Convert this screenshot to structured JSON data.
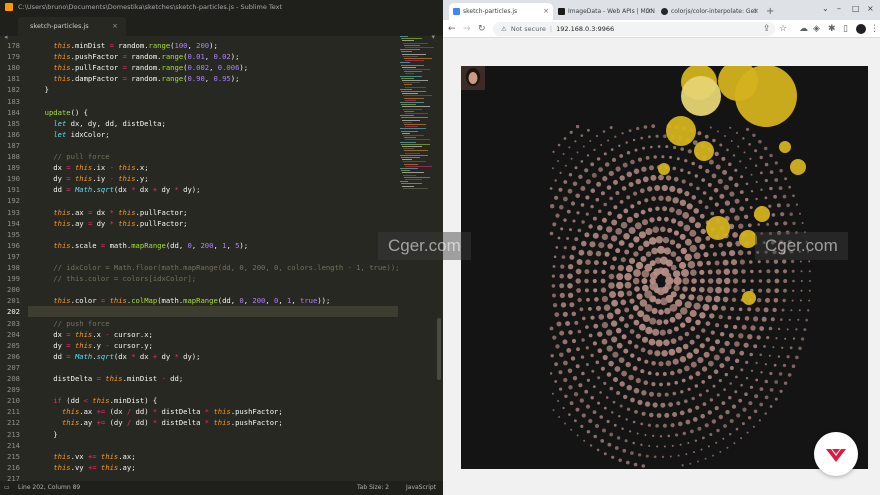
{
  "editor": {
    "title": "C:\\Users\\bruno\\Documents\\Domestika\\sketches\\sketch-particles.js - Sublime Text",
    "tab_label": "sketch-particles.js",
    "status": {
      "position": "Line 202, Column 89",
      "tab_size": "Tab Size: 2",
      "syntax": "JavaScript"
    },
    "line_numbers": [
      "178",
      "179",
      "180",
      "181",
      "182",
      "183",
      "184",
      "185",
      "186",
      "187",
      "188",
      "189",
      "190",
      "191",
      "192",
      "193",
      "194",
      "195",
      "196",
      "197",
      "198",
      "199",
      "200",
      "201",
      "202",
      "203",
      "204",
      "205",
      "206",
      "207",
      "208",
      "209",
      "210",
      "211",
      "212",
      "213",
      "214",
      "215",
      "216",
      "217"
    ],
    "current_line": "202",
    "code_lines": [
      [
        {
          "t": "    "
        },
        {
          "t": "this",
          "c": "th"
        },
        {
          "t": ".minDist "
        },
        {
          "t": "=",
          "c": "op"
        },
        {
          "t": " random."
        },
        {
          "t": "range",
          "c": "fn"
        },
        {
          "t": "("
        },
        {
          "t": "100",
          "c": "nu"
        },
        {
          "t": ", "
        },
        {
          "t": "200",
          "c": "nu"
        },
        {
          "t": ");"
        }
      ],
      [
        {
          "t": "    "
        },
        {
          "t": "this",
          "c": "th"
        },
        {
          "t": ".pushFactor "
        },
        {
          "t": "=",
          "c": "op"
        },
        {
          "t": " random."
        },
        {
          "t": "range",
          "c": "fn"
        },
        {
          "t": "("
        },
        {
          "t": "0.01",
          "c": "nu"
        },
        {
          "t": ", "
        },
        {
          "t": "0.02",
          "c": "nu"
        },
        {
          "t": ");"
        }
      ],
      [
        {
          "t": "    "
        },
        {
          "t": "this",
          "c": "th"
        },
        {
          "t": ".pullFactor "
        },
        {
          "t": "=",
          "c": "op"
        },
        {
          "t": " random."
        },
        {
          "t": "range",
          "c": "fn"
        },
        {
          "t": "("
        },
        {
          "t": "0.002",
          "c": "nu"
        },
        {
          "t": ", "
        },
        {
          "t": "0.006",
          "c": "nu"
        },
        {
          "t": ");"
        }
      ],
      [
        {
          "t": "    "
        },
        {
          "t": "this",
          "c": "th"
        },
        {
          "t": ".dampFactor "
        },
        {
          "t": "=",
          "c": "op"
        },
        {
          "t": " random."
        },
        {
          "t": "range",
          "c": "fn"
        },
        {
          "t": "("
        },
        {
          "t": "0.90",
          "c": "nu"
        },
        {
          "t": ", "
        },
        {
          "t": "0.95",
          "c": "nu"
        },
        {
          "t": ");"
        }
      ],
      [
        {
          "t": "  }"
        }
      ],
      [
        {
          "t": ""
        }
      ],
      [
        {
          "t": "  "
        },
        {
          "t": "update",
          "c": "fn"
        },
        {
          "t": "() {"
        }
      ],
      [
        {
          "t": "    "
        },
        {
          "t": "let",
          "c": "kw"
        },
        {
          "t": " dx, dy, dd, distDelta;"
        }
      ],
      [
        {
          "t": "    "
        },
        {
          "t": "let",
          "c": "kw"
        },
        {
          "t": " idxColor;"
        }
      ],
      [
        {
          "t": ""
        }
      ],
      [
        {
          "t": "    "
        },
        {
          "t": "// pull force",
          "c": "cm"
        }
      ],
      [
        {
          "t": "    dx "
        },
        {
          "t": "=",
          "c": "op"
        },
        {
          "t": " "
        },
        {
          "t": "this",
          "c": "th"
        },
        {
          "t": ".ix "
        },
        {
          "t": "-",
          "c": "op"
        },
        {
          "t": " "
        },
        {
          "t": "this",
          "c": "th"
        },
        {
          "t": ".x;"
        }
      ],
      [
        {
          "t": "    dy "
        },
        {
          "t": "=",
          "c": "op"
        },
        {
          "t": " "
        },
        {
          "t": "this",
          "c": "th"
        },
        {
          "t": ".iy "
        },
        {
          "t": "-",
          "c": "op"
        },
        {
          "t": " "
        },
        {
          "t": "this",
          "c": "th"
        },
        {
          "t": ".y;"
        }
      ],
      [
        {
          "t": "    dd "
        },
        {
          "t": "=",
          "c": "op"
        },
        {
          "t": " "
        },
        {
          "t": "Math",
          "c": "kw"
        },
        {
          "t": "."
        },
        {
          "t": "sqrt",
          "c": "kw"
        },
        {
          "t": "(dx "
        },
        {
          "t": "*",
          "c": "op"
        },
        {
          "t": " dx "
        },
        {
          "t": "+",
          "c": "op"
        },
        {
          "t": " dy "
        },
        {
          "t": "*",
          "c": "op"
        },
        {
          "t": " dy);"
        }
      ],
      [
        {
          "t": ""
        }
      ],
      [
        {
          "t": "    "
        },
        {
          "t": "this",
          "c": "th"
        },
        {
          "t": ".ax "
        },
        {
          "t": "=",
          "c": "op"
        },
        {
          "t": " dx "
        },
        {
          "t": "*",
          "c": "op"
        },
        {
          "t": " "
        },
        {
          "t": "this",
          "c": "th"
        },
        {
          "t": ".pullFactor;"
        }
      ],
      [
        {
          "t": "    "
        },
        {
          "t": "this",
          "c": "th"
        },
        {
          "t": ".ay "
        },
        {
          "t": "=",
          "c": "op"
        },
        {
          "t": " dy "
        },
        {
          "t": "*",
          "c": "op"
        },
        {
          "t": " "
        },
        {
          "t": "this",
          "c": "th"
        },
        {
          "t": ".pullFactor;"
        }
      ],
      [
        {
          "t": ""
        }
      ],
      [
        {
          "t": "    "
        },
        {
          "t": "this",
          "c": "th"
        },
        {
          "t": ".scale "
        },
        {
          "t": "=",
          "c": "op"
        },
        {
          "t": " math."
        },
        {
          "t": "mapRange",
          "c": "fn"
        },
        {
          "t": "(dd, "
        },
        {
          "t": "0",
          "c": "nu"
        },
        {
          "t": ", "
        },
        {
          "t": "200",
          "c": "nu"
        },
        {
          "t": ", "
        },
        {
          "t": "1",
          "c": "nu"
        },
        {
          "t": ", "
        },
        {
          "t": "5",
          "c": "nu"
        },
        {
          "t": ");"
        }
      ],
      [
        {
          "t": ""
        }
      ],
      [
        {
          "t": "    // idxColor = Math.floor(math.mapRange(dd, 0, 200, 0, colors.length - 1, true));",
          "c": "cm"
        }
      ],
      [
        {
          "t": "    // this.color = colors[idxColor];",
          "c": "cm"
        }
      ],
      [
        {
          "t": ""
        }
      ],
      [
        {
          "t": "    "
        },
        {
          "t": "this",
          "c": "th"
        },
        {
          "t": ".color "
        },
        {
          "t": "=",
          "c": "op"
        },
        {
          "t": " "
        },
        {
          "t": "this",
          "c": "th"
        },
        {
          "t": "."
        },
        {
          "t": "colMap",
          "c": "fn"
        },
        {
          "t": "(math."
        },
        {
          "t": "mapRange",
          "c": "fn"
        },
        {
          "t": "(dd, "
        },
        {
          "t": "0",
          "c": "nu"
        },
        {
          "t": ", "
        },
        {
          "t": "200",
          "c": "nu"
        },
        {
          "t": ", "
        },
        {
          "t": "0",
          "c": "nu"
        },
        {
          "t": ", "
        },
        {
          "t": "1",
          "c": "nu"
        },
        {
          "t": ", "
        },
        {
          "t": "true",
          "c": "nu"
        },
        {
          "t": "));"
        }
      ],
      [
        {
          "t": ""
        }
      ],
      [
        {
          "t": "    "
        },
        {
          "t": "// push force",
          "c": "cm"
        }
      ],
      [
        {
          "t": "    dx "
        },
        {
          "t": "=",
          "c": "op"
        },
        {
          "t": " "
        },
        {
          "t": "this",
          "c": "th"
        },
        {
          "t": ".x "
        },
        {
          "t": "-",
          "c": "op"
        },
        {
          "t": " cursor.x;"
        }
      ],
      [
        {
          "t": "    dy "
        },
        {
          "t": "=",
          "c": "op"
        },
        {
          "t": " "
        },
        {
          "t": "this",
          "c": "th"
        },
        {
          "t": ".y "
        },
        {
          "t": "-",
          "c": "op"
        },
        {
          "t": " cursor.y;"
        }
      ],
      [
        {
          "t": "    dd "
        },
        {
          "t": "=",
          "c": "op"
        },
        {
          "t": " "
        },
        {
          "t": "Math",
          "c": "kw"
        },
        {
          "t": "."
        },
        {
          "t": "sqrt",
          "c": "kw"
        },
        {
          "t": "(dx "
        },
        {
          "t": "*",
          "c": "op"
        },
        {
          "t": " dx "
        },
        {
          "t": "+",
          "c": "op"
        },
        {
          "t": " dy "
        },
        {
          "t": "*",
          "c": "op"
        },
        {
          "t": " dy);"
        }
      ],
      [
        {
          "t": ""
        }
      ],
      [
        {
          "t": "    distDelta "
        },
        {
          "t": "=",
          "c": "op"
        },
        {
          "t": " "
        },
        {
          "t": "this",
          "c": "th"
        },
        {
          "t": ".minDist "
        },
        {
          "t": "-",
          "c": "op"
        },
        {
          "t": " dd;"
        }
      ],
      [
        {
          "t": ""
        }
      ],
      [
        {
          "t": "    "
        },
        {
          "t": "if",
          "c": "op"
        },
        {
          "t": " (dd "
        },
        {
          "t": "<",
          "c": "op"
        },
        {
          "t": " "
        },
        {
          "t": "this",
          "c": "th"
        },
        {
          "t": ".minDist) {"
        }
      ],
      [
        {
          "t": "      "
        },
        {
          "t": "this",
          "c": "th"
        },
        {
          "t": ".ax "
        },
        {
          "t": "+=",
          "c": "op"
        },
        {
          "t": " (dx "
        },
        {
          "t": "/",
          "c": "op"
        },
        {
          "t": " dd) "
        },
        {
          "t": "*",
          "c": "op"
        },
        {
          "t": " distDelta "
        },
        {
          "t": "*",
          "c": "op"
        },
        {
          "t": " "
        },
        {
          "t": "this",
          "c": "th"
        },
        {
          "t": ".pushFactor;"
        }
      ],
      [
        {
          "t": "      "
        },
        {
          "t": "this",
          "c": "th"
        },
        {
          "t": ".ay "
        },
        {
          "t": "+=",
          "c": "op"
        },
        {
          "t": " (dy "
        },
        {
          "t": "/",
          "c": "op"
        },
        {
          "t": " dd) "
        },
        {
          "t": "*",
          "c": "op"
        },
        {
          "t": " distDelta "
        },
        {
          "t": "*",
          "c": "op"
        },
        {
          "t": " "
        },
        {
          "t": "this",
          "c": "th"
        },
        {
          "t": ".pushFactor;"
        }
      ],
      [
        {
          "t": "    }"
        }
      ],
      [
        {
          "t": ""
        }
      ],
      [
        {
          "t": "    "
        },
        {
          "t": "this",
          "c": "th"
        },
        {
          "t": ".vx "
        },
        {
          "t": "+=",
          "c": "op"
        },
        {
          "t": " "
        },
        {
          "t": "this",
          "c": "th"
        },
        {
          "t": ".ax;"
        }
      ],
      [
        {
          "t": "    "
        },
        {
          "t": "this",
          "c": "th"
        },
        {
          "t": ".vy "
        },
        {
          "t": "+=",
          "c": "op"
        },
        {
          "t": " "
        },
        {
          "t": "this",
          "c": "th"
        },
        {
          "t": ".ay;"
        }
      ]
    ]
  },
  "browser": {
    "tabs": [
      {
        "label": "sketch-particles.js",
        "active": true,
        "favicon_color": "#4285f4"
      },
      {
        "label": "ImageData - Web APIs | MDN",
        "active": false,
        "favicon_color": "#1b1b1b"
      },
      {
        "label": "colorjs/color-interpolate: Get",
        "active": false,
        "favicon_color": "#24292f"
      }
    ],
    "omnibox": {
      "security": "Not secure",
      "url": "192.168.0.3:9966"
    }
  },
  "watermark": {
    "left": "Cger.com",
    "right": "Cger.com"
  },
  "colors": {
    "editor_bg": "#272822",
    "particle_near": "#e8c4c0",
    "particle_far": "#d4b21e",
    "canvas_bg": "#141414"
  }
}
